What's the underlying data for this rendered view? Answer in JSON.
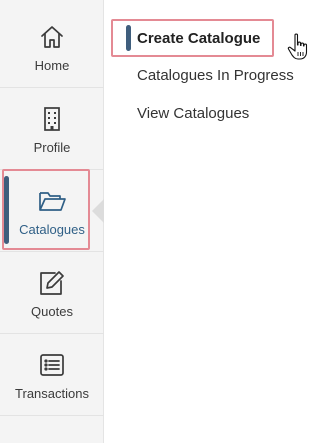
{
  "sidebar": {
    "items": [
      {
        "label": "Home",
        "icon": "home-icon"
      },
      {
        "label": "Profile",
        "icon": "building-icon"
      },
      {
        "label": "Catalogues",
        "icon": "folder-open-icon"
      },
      {
        "label": "Quotes",
        "icon": "edit-icon"
      },
      {
        "label": "Transactions",
        "icon": "list-icon"
      }
    ],
    "active_index": 2
  },
  "submenu": {
    "items": [
      {
        "label": "Create Catalogue"
      },
      {
        "label": "Catalogues In Progress"
      },
      {
        "label": "View Catalogues"
      }
    ],
    "active_index": 0
  },
  "colors": {
    "accent": "#3f5e7d",
    "highlight": "#e48a94",
    "sidebar_bg": "#f4f4f4",
    "icon": "#3b3b3b",
    "active_icon": "#2f5f86"
  }
}
